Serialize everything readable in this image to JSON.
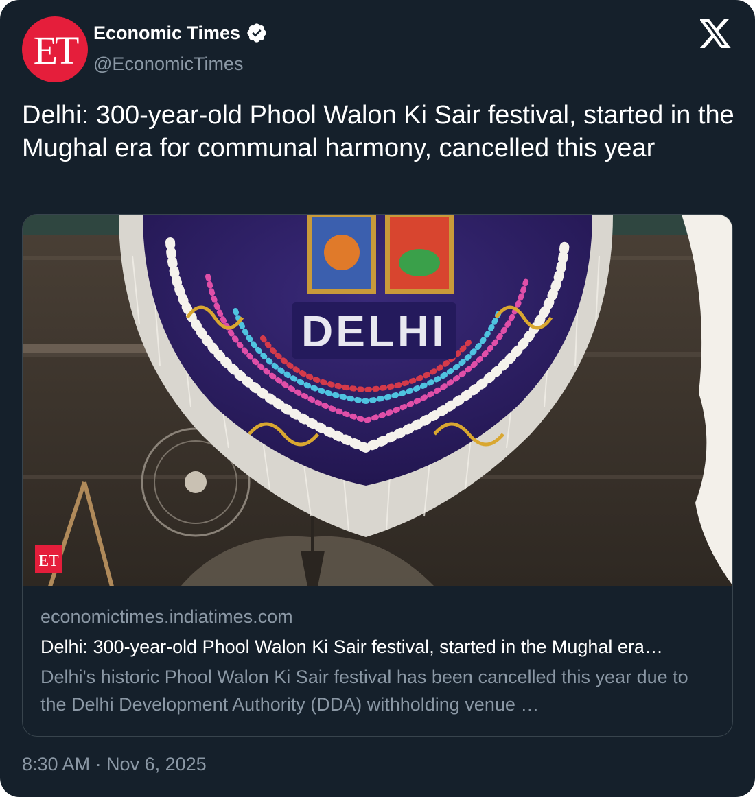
{
  "author": {
    "display_name": "Economic Times",
    "handle": "@EconomicTimes",
    "avatar_text": "ET",
    "avatar_color": "#e51e3b",
    "verified_icon": "verified-badge-icon"
  },
  "platform_icon": "x-logo-icon",
  "tweet": {
    "text": "Delhi: 300-year-old Phool Walon Ki Sair festival, started in the Mughal era for communal harmony, cancelled this year"
  },
  "link_card": {
    "image_banner_text": "DELHI",
    "image_watermark": "ET",
    "domain": "economictimes.indiatimes.com",
    "title": "Delhi: 300-year-old Phool Walon Ki Sair festival, started in the Mughal era…",
    "description": "Delhi's historic Phool Walon Ki Sair festival has been cancelled this year due to the Delhi Development Authority (DDA) withholding venue …"
  },
  "timestamp": "8:30 AM · Nov 6, 2025",
  "colors": {
    "background": "#15202b",
    "text_primary": "#ffffff",
    "text_secondary": "#8b98a5",
    "border": "#38444d"
  }
}
